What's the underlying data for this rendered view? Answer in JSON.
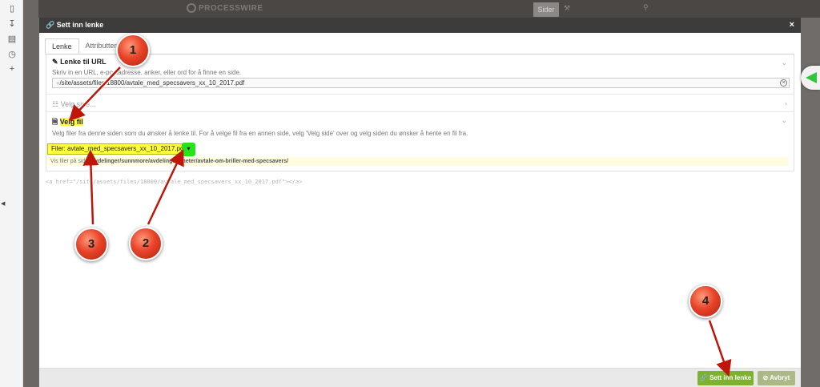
{
  "topbar": {
    "logo": "PROCESSWIRE",
    "tab": "Sider"
  },
  "dialog": {
    "title": "Sett inn lenke",
    "close": "×",
    "tabs": [
      {
        "label": "Lenke"
      },
      {
        "label": "Attributter"
      }
    ],
    "url_section": {
      "title": "Lenke til URL",
      "description": "Skriv in en URL, e-postadresse, anker, eller ord for å finne en side.",
      "value": "/site/assets/files/18800/avtale_med_specsavers_xx_10_2017.pdf"
    },
    "page_section": {
      "title": "Velg side..."
    },
    "file_section": {
      "title": "Velg fil",
      "description": "Velg filer fra denne siden som du ønsker å lenke til. For å velge fil fra en annen side, velg 'Velg side' over og velg siden du ønsker å hente en fil fra.",
      "select_value": "Filer: avtale_med_specsavers_xx_10_2017.pdf",
      "shown_prefix": "Vis filer på side:",
      "shown_path": "avdelinger/sunnmore/avdelingsnyheter/avtale-om-briller-med-specsavers/"
    },
    "code_preview": "<a href=\"/site/assets/files/18800/avtale_med_specsavers_xx_10_2017.pdf\"></a>",
    "buttons": {
      "insert": "Sett inn lenke",
      "cancel": "Avbryt"
    }
  },
  "annotations": [
    "1",
    "2",
    "3",
    "4"
  ],
  "colors": {
    "accent_green": "#7cb22e",
    "highlight": "#ffff3b",
    "marker_red": "#e8442a"
  }
}
